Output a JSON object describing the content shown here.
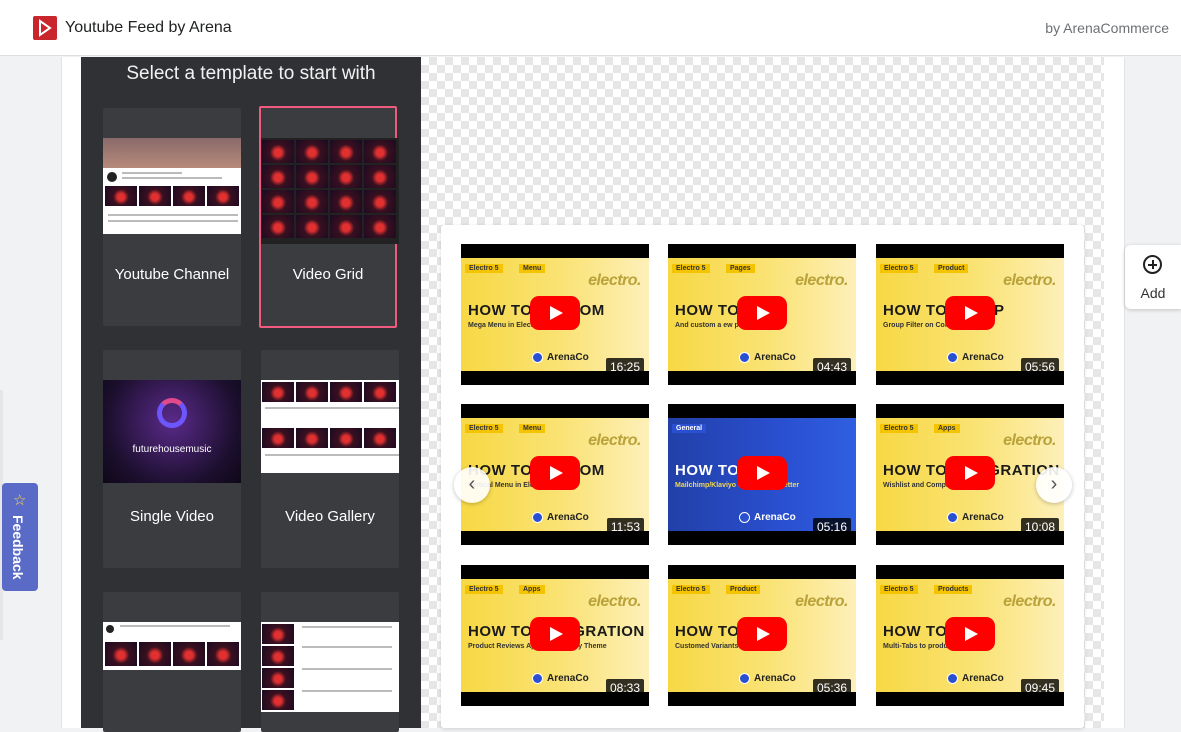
{
  "header": {
    "app_title": "Youtube Feed by Arena",
    "by_line": "by ArenaCommerce"
  },
  "panel": {
    "title": "Select a template to start with",
    "templates": [
      {
        "label": "Youtube Channel",
        "selected": false
      },
      {
        "label": "Video Grid",
        "selected": true
      },
      {
        "label": "Single Video",
        "selected": false
      },
      {
        "label": "Video Gallery",
        "selected": false
      },
      {
        "label": "",
        "selected": false
      },
      {
        "label": "",
        "selected": false
      }
    ],
    "thumb_text": {
      "single_video_brand": "futurehousemusic"
    }
  },
  "preview": {
    "videos": [
      {
        "tag1": "Electro 5",
        "tag2": "Menu",
        "brand": "electro.",
        "headline": "HOW TO CUSTOM",
        "subline": "Mega Menu in Electro 5 Theme",
        "ac": "ArenaCo",
        "duration": "16:25",
        "style": "yellow"
      },
      {
        "tag1": "Electro 5",
        "tag2": "Pages",
        "brand": "electro.",
        "headline": "HOW TO ADD",
        "subline": "And custom a ew page",
        "ac": "ArenaCo",
        "duration": "04:43",
        "style": "yellow"
      },
      {
        "tag1": "Electro 5",
        "tag2": "Product",
        "brand": "electro.",
        "headline": "HOW TO SETUP",
        "subline": "Group Filter on Collection Page",
        "ac": "ArenaCo",
        "duration": "05:56",
        "style": "yellow"
      },
      {
        "tag1": "Electro 5",
        "tag2": "Menu",
        "brand": "electro.",
        "headline": "HOW TO CUSTOM",
        "subline": "Vertical Menu in Electro 5 Theme",
        "ac": "ArenaCo",
        "duration": "11:53",
        "style": "yellow"
      },
      {
        "tag1": "General",
        "tag2": "",
        "brand": "",
        "headline": "HOW TO LINK",
        "subline": "Mailchimp/Klaviyo to your Newsletter",
        "ac": "ArenaCo",
        "duration": "05:16",
        "style": "blue"
      },
      {
        "tag1": "Electro 5",
        "tag2": "Apps",
        "brand": "electro.",
        "headline": "HOW TO INTEGRATION",
        "subline": "Wishlist and Compare app",
        "ac": "ArenaCo",
        "duration": "10:08",
        "style": "yellow"
      },
      {
        "tag1": "Electro 5",
        "tag2": "Apps",
        "brand": "electro.",
        "headline": "HOW TO INTEGRATION",
        "subline": "Product Reviews App into Shopify Theme",
        "ac": "ArenaCo",
        "duration": "08:33",
        "style": "yellow"
      },
      {
        "tag1": "Electro 5",
        "tag2": "Product",
        "brand": "electro.",
        "headline": "HOW TO ADD",
        "subline": "Customed Variants Swatches",
        "ac": "ArenaCo",
        "duration": "05:36",
        "style": "yellow"
      },
      {
        "tag1": "Electro 5",
        "tag2": "Products",
        "brand": "electro.",
        "headline": "HOW TO ADD",
        "subline": "Multi-Tabs to product pages",
        "ac": "ArenaCo",
        "duration": "09:45",
        "style": "yellow"
      }
    ],
    "prev_arrow": "‹",
    "next_arrow": "›"
  },
  "add_button": {
    "label": "Add"
  },
  "feedback": {
    "label": "Feedback",
    "icon": "☆"
  },
  "colors": {
    "panel_bg": "#2f3134",
    "selected_border": "#f05a7e",
    "logo_red": "#c8252c",
    "play_red": "#ff0000",
    "feedback_blue": "#5a6bc7"
  }
}
